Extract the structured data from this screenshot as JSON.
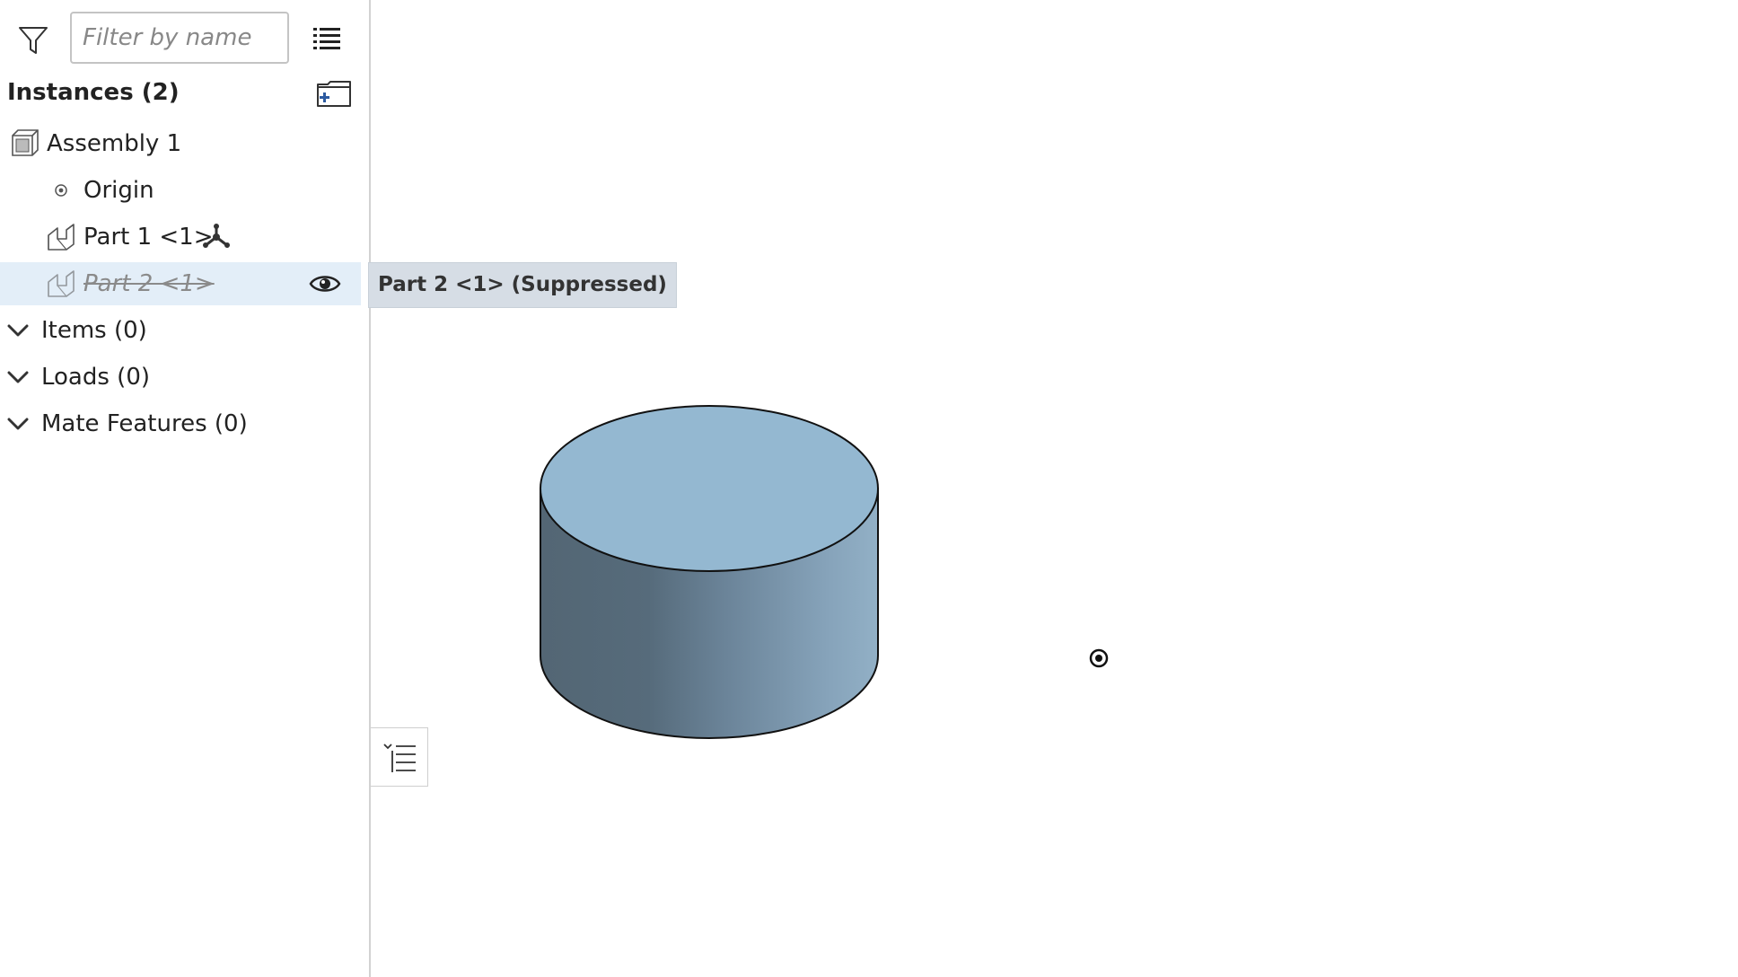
{
  "filter": {
    "placeholder": "Filter by name"
  },
  "instances": {
    "title": "Instances (2)",
    "rows": [
      {
        "label": "Assembly 1"
      },
      {
        "label": "Origin"
      },
      {
        "label": "Part 1 <1>"
      },
      {
        "label": "Part 2 <1>",
        "suppressed": true
      }
    ]
  },
  "sections": [
    {
      "label": "Items (0)"
    },
    {
      "label": "Loads (0)"
    },
    {
      "label": "Mate Features (0)"
    }
  ],
  "tooltip": {
    "text": "Part 2 <1> (Suppressed)"
  },
  "colors": {
    "selected_row": "#e3eef8",
    "tooltip_bg": "#d6dde5",
    "cylinder_top": "#94b8d1",
    "cylinder_side_dark": "#536674",
    "cylinder_side_light": "#8aaac0",
    "accent_blue": "#2c5aa0"
  },
  "icons": {
    "filter": "filter-icon",
    "list": "list-view-icon",
    "new_folder": "new-folder-icon",
    "assembly": "assembly-icon",
    "origin": "origin-icon",
    "part": "part-icon",
    "mate_connector": "mate-connector-icon",
    "visibility": "eye-icon",
    "chevron": "chevron-down-icon",
    "list_toggle": "list-toggle-icon"
  }
}
